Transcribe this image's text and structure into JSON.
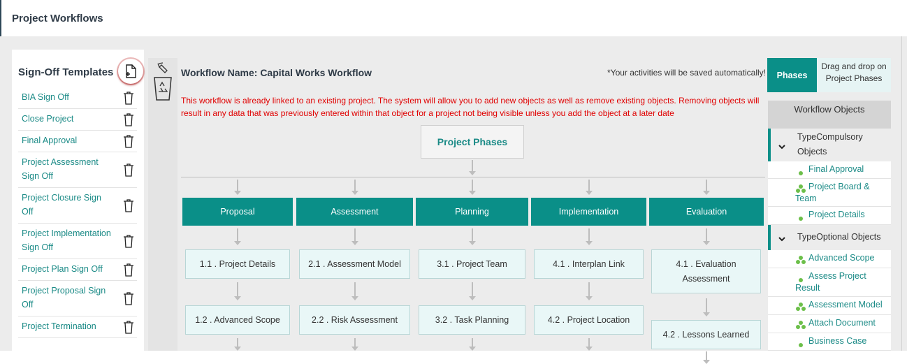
{
  "page": {
    "title": "Project Workflows"
  },
  "sign_off": {
    "title": "Sign-Off Templates",
    "add_icon": "add-document-icon",
    "delete_icon": "trash-icon",
    "templates": [
      {
        "label": "BIA Sign Off"
      },
      {
        "label": "Close Project"
      },
      {
        "label": "Final Approval"
      },
      {
        "label": "Project Assessment Sign Off"
      },
      {
        "label": "Project Closure Sign Off"
      },
      {
        "label": "Project Implementation Sign Off"
      },
      {
        "label": "Project Plan Sign Off"
      },
      {
        "label": "Project Proposal Sign Off"
      },
      {
        "label": "Project Termination"
      }
    ]
  },
  "recycle_bin": {
    "icon": "recycle-bin-icon"
  },
  "workflow": {
    "name_label": "Workflow Name: Capital Works Workflow",
    "autosave_note": "*Your activities will be saved automatically!",
    "warning": "This workflow is already linked to an existing project. The system will allow you to add new objects as well as remove existing objects. Removing objects will result in any data that was previously entered within that object for a project not being visible unless you add the object at a later date",
    "root_label": "Project Phases",
    "phases": [
      {
        "label": "Proposal",
        "objects": [
          "1.1 . Project Details",
          "1.2 . Advanced Scope"
        ]
      },
      {
        "label": "Assessment",
        "objects": [
          "2.1 . Assessment Model",
          "2.2 . Risk Assessment"
        ]
      },
      {
        "label": "Planning",
        "objects": [
          "3.1 . Project Team",
          "3.2 . Task Planning"
        ]
      },
      {
        "label": "Implementation",
        "objects": [
          "4.1 . Interplan Link",
          "4.2 . Project Location"
        ]
      },
      {
        "label": "Evaluation",
        "objects": [
          "4.1 . Evaluation Assessment",
          "4.2 . Lessons Learned"
        ]
      }
    ]
  },
  "right_panel": {
    "phases_button": "Phases",
    "drag_hint": "Drag and drop on Project Phases",
    "objects_title": "Workflow Objects",
    "groups": [
      {
        "label": "TypeCompulsory Objects",
        "items": [
          {
            "label": "Final Approval",
            "icon": "single-dot-icon"
          },
          {
            "label": "Project Board & Team",
            "icon": "multi-dot-icon"
          },
          {
            "label": "Project Details",
            "icon": "single-dot-icon"
          }
        ]
      },
      {
        "label": "TypeOptional Objects",
        "items": [
          {
            "label": "Advanced Scope",
            "icon": "multi-dot-icon"
          },
          {
            "label": "Assess Project Result",
            "icon": "single-dot-icon"
          },
          {
            "label": "Assessment Model",
            "icon": "multi-dot-icon"
          },
          {
            "label": "Attach Document",
            "icon": "multi-dot-icon"
          },
          {
            "label": "Business Case",
            "icon": "single-dot-icon"
          }
        ]
      }
    ]
  },
  "colors": {
    "teal": "#0a8f88",
    "warning": "#e00000",
    "link": "#1a8a86"
  }
}
